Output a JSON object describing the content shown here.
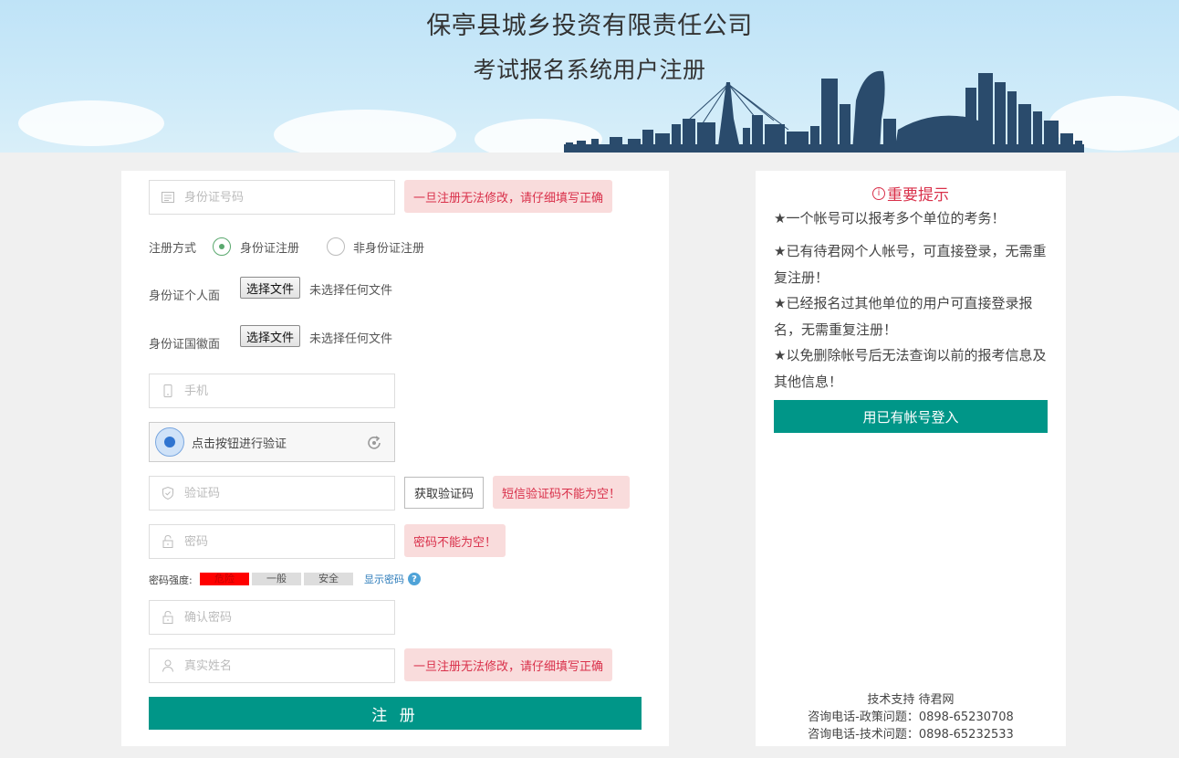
{
  "header": {
    "company": "保亭县城乡投资有限责任公司",
    "subtitle": "考试报名系统用户注册"
  },
  "form": {
    "id_placeholder": "身份证号码",
    "id_tip": "一旦注册无法修改，请仔细填写正确",
    "reg_method_label": "注册方式",
    "reg_opt_id": "身份证注册",
    "reg_opt_nonid": "非身份证注册",
    "id_front_label": "身份证个人面",
    "id_back_label": "身份证国徽面",
    "file_btn": "选择文件",
    "no_file": "未选择任何文件",
    "phone_placeholder": "手机",
    "captcha_text": "点击按钮进行验证",
    "code_placeholder": "验证码",
    "get_code": "获取验证码",
    "code_tip": "短信验证码不能为空！",
    "password_placeholder": "密码",
    "password_tip": "密码不能为空！",
    "strength_label": "密码强度:",
    "strength_levels": [
      "危险",
      "一般",
      "安全"
    ],
    "show_password": "显示密码",
    "confirm_placeholder": "确认密码",
    "name_placeholder": "真实姓名",
    "name_tip": "一旦注册无法修改，请仔细填写正确",
    "submit": "注 册"
  },
  "notice": {
    "title": "重要提示",
    "items": [
      "★一个帐号可以报考多个单位的考务！",
      "★已有待君网个人帐号，可直接登录，无需重复注册！",
      "★已经报名过其他单位的用户可直接登录报名，无需重复注册！",
      "★以免删除帐号后无法查询以前的报考信息及其他信息！"
    ],
    "login_button": "用已有帐号登入",
    "support": "技术支持 待君网",
    "policy_phone": "咨询电话-政策问题：0898-65230708",
    "tech_phone": "咨询电话-技术问题：0898-65232533"
  },
  "colors": {
    "accent": "#009688",
    "error_bg": "#f9dcdc",
    "error_text": "#d9304a",
    "danger_bar": "#ff0000"
  }
}
